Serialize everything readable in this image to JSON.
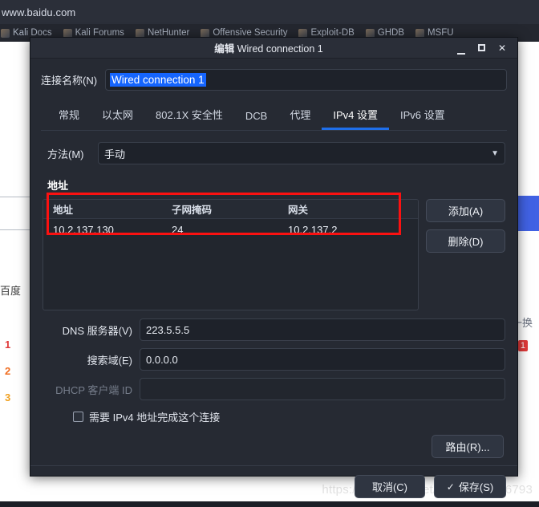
{
  "browser": {
    "url": "www.baidu.com",
    "bookmarks": [
      {
        "label": "Kali Docs"
      },
      {
        "label": "Kali Forums"
      },
      {
        "label": "NetHunter"
      },
      {
        "label": "Offensive Security"
      },
      {
        "label": "Exploit-DB"
      },
      {
        "label": "GHDB"
      },
      {
        "label": "MSFU"
      }
    ],
    "page": {
      "brand": "百度",
      "results": [
        "1",
        "2",
        "3"
      ],
      "right_text": "一换"
    },
    "watermark": "https://blog.csdn.net/weixin_45776793"
  },
  "dialog": {
    "title_prefix": "编辑",
    "title_name": "Wired connection 1",
    "window_controls": {
      "minimize": "minimize-icon",
      "maximize": "maximize-icon",
      "close": "✕"
    },
    "connection_name": {
      "label": "连接名称(N)",
      "value": "Wired connection 1"
    },
    "tabs": [
      {
        "label": "常规",
        "active": false
      },
      {
        "label": "以太网",
        "active": false
      },
      {
        "label": "802.1X 安全性",
        "active": false
      },
      {
        "label": "DCB",
        "active": false
      },
      {
        "label": "代理",
        "active": false
      },
      {
        "label": "IPv4 设置",
        "active": true
      },
      {
        "label": "IPv6 设置",
        "active": false
      }
    ],
    "method": {
      "label": "方法(M)",
      "value": "手动",
      "chevron": "▼"
    },
    "addresses": {
      "section_title": "地址",
      "columns": [
        "地址",
        "子网掩码",
        "网关"
      ],
      "rows": [
        {
          "address": "10.2.137.130",
          "netmask": "24",
          "gateway": "10.2.137.2"
        }
      ],
      "add_button": "添加(A)",
      "delete_button": "删除(D)",
      "highlight_color": "#fb1111"
    },
    "dns": {
      "label": "DNS 服务器(V)",
      "value": "223.5.5.5"
    },
    "search_domain": {
      "label": "搜索域(E)",
      "value": "0.0.0.0"
    },
    "dhcp_client_id": {
      "label": "DHCP 客户端 ID",
      "value": ""
    },
    "require_ipv4": {
      "label": "需要 IPv4 地址完成这个连接",
      "checked": false
    },
    "routes_button": "路由(R)...",
    "cancel_button": "取消(C)",
    "save_button": "保存(S)",
    "save_check": "✓"
  }
}
